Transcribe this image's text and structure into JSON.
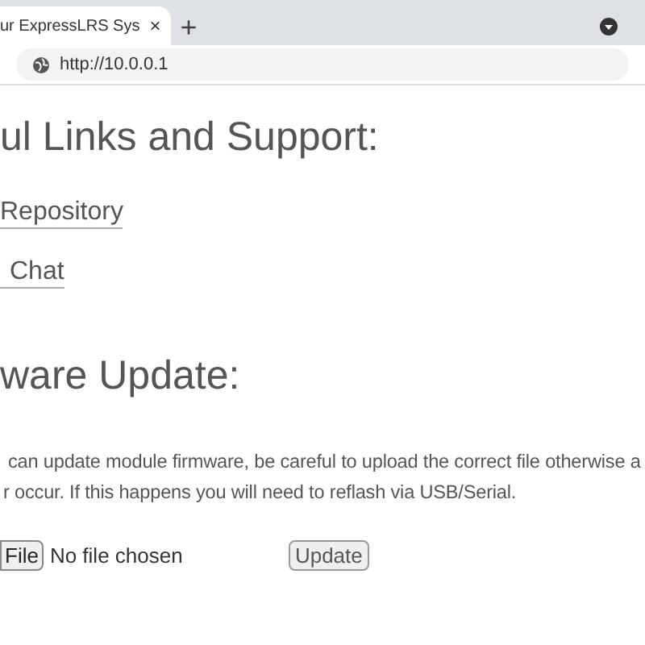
{
  "browser": {
    "tab": {
      "title": "ur ExpressLRS Sys",
      "close": "×",
      "selected": true
    },
    "new_tab": "+",
    "url": "http://10.0.0.1"
  },
  "links_heading": "ul Links and Support:",
  "links": [
    "Repository",
    "Chat"
  ],
  "update_heading": "ware Update:",
  "description": [
    "can update module firmware, be careful to upload the correct file otherwise a",
    "r occur. If this happens you will need to reflash via USB/Serial."
  ],
  "file_input": {
    "button": "File",
    "status": "No file chosen"
  },
  "update_button": "Update"
}
